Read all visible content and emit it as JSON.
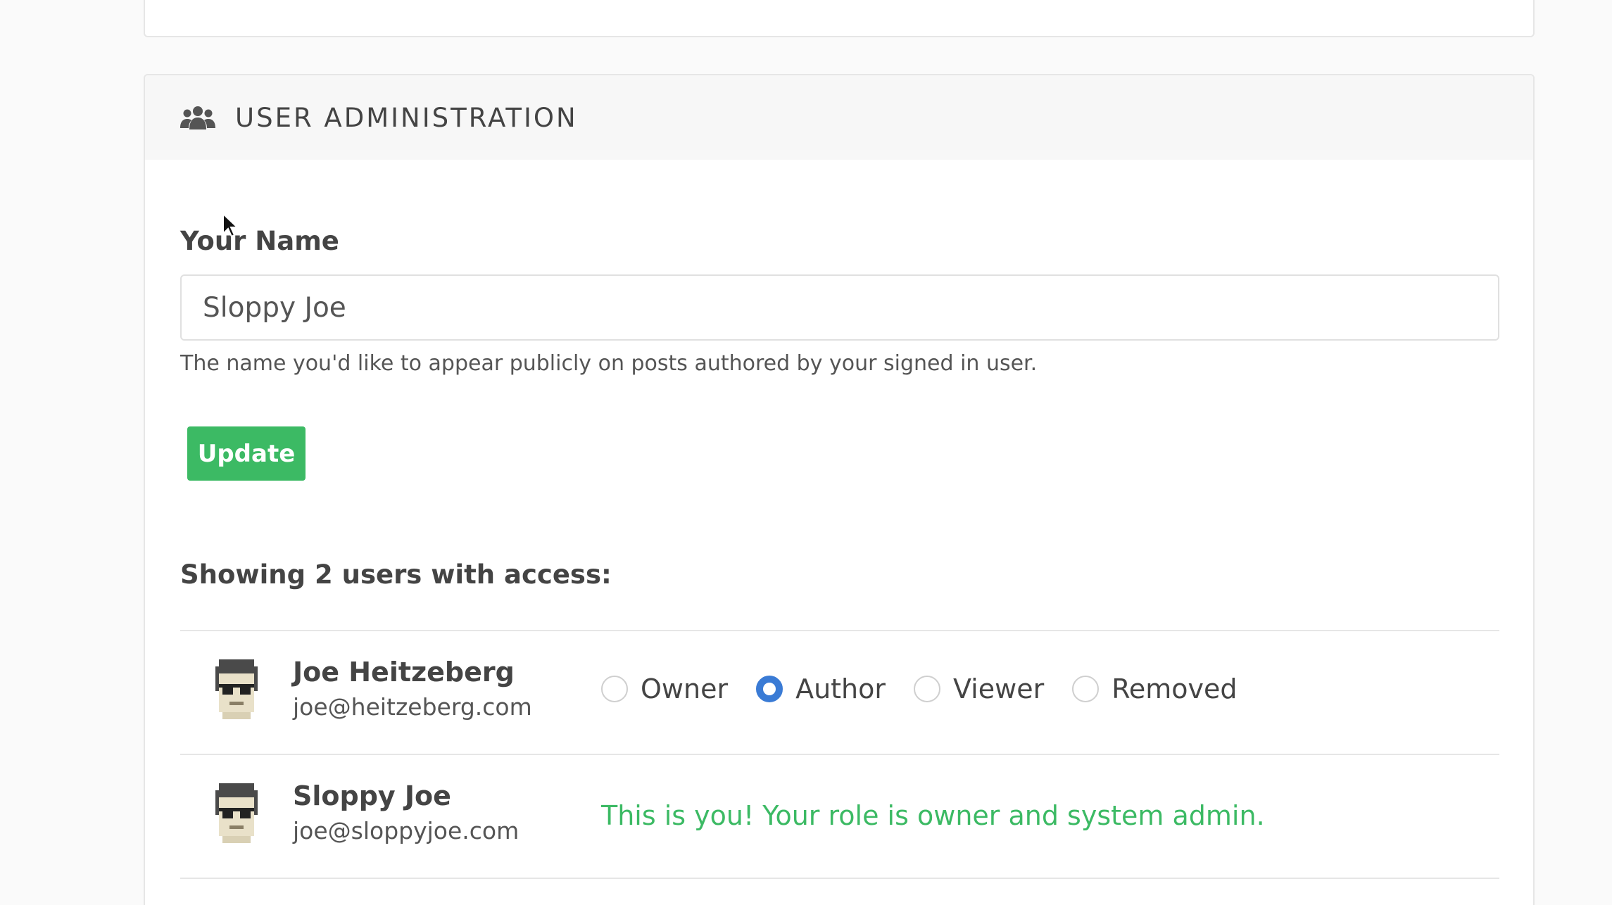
{
  "section": {
    "title": "USER ADMINISTRATION",
    "icon": "users-icon"
  },
  "name_form": {
    "label": "Your Name",
    "value": "Sloppy Joe",
    "help": "The name you'd like to appear publicly on posts authored by your signed in user.",
    "update_label": "Update"
  },
  "users_heading": "Showing 2 users with access:",
  "role_options": [
    "Owner",
    "Author",
    "Viewer",
    "Removed"
  ],
  "users": [
    {
      "name": "Joe Heitzeberg",
      "email": "joe@heitzeberg.com",
      "selected_role": "Author"
    },
    {
      "name": "Sloppy Joe",
      "email": "joe@sloppyjoe.com",
      "self_message": "This is you! Your role is owner and system admin."
    }
  ],
  "colors": {
    "accent_green": "#3cba64",
    "radio_selected": "#3a7bd5",
    "header_bg": "#f7f7f7"
  }
}
